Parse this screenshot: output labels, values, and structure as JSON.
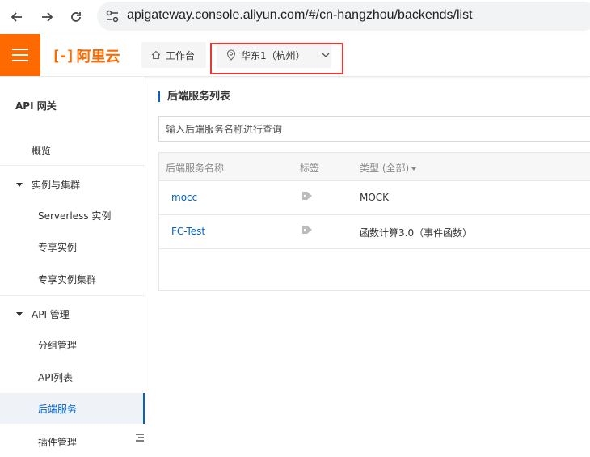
{
  "browser": {
    "url": "apigateway.console.aliyun.com/#/cn-hangzhou/backends/list"
  },
  "header": {
    "logo_text": "阿里云",
    "workbench_label": "工作台",
    "region_label": "华东1（杭州）",
    "accent_color": "#ff6a00"
  },
  "sidebar": {
    "title": "API 网关",
    "overview": "概览",
    "instances_group": "实例与集群",
    "instances": [
      "Serverless 实例",
      "专享实例",
      "专享实例集群"
    ],
    "api_group": "API 管理",
    "api_items": [
      "分组管理",
      "API列表",
      "后端服务",
      "插件管理"
    ],
    "active_item": "后端服务",
    "active_color": "#0064c8"
  },
  "main": {
    "title": "后端服务列表",
    "search_placeholder": "输入后端服务名称进行查询",
    "columns": [
      "后端服务名称",
      "标签",
      "类型 (全部)"
    ],
    "rows": [
      {
        "name": "mocc",
        "type": "MOCK"
      },
      {
        "name": "FC-Test",
        "type": "函数计算3.0（事件函数）"
      }
    ]
  }
}
